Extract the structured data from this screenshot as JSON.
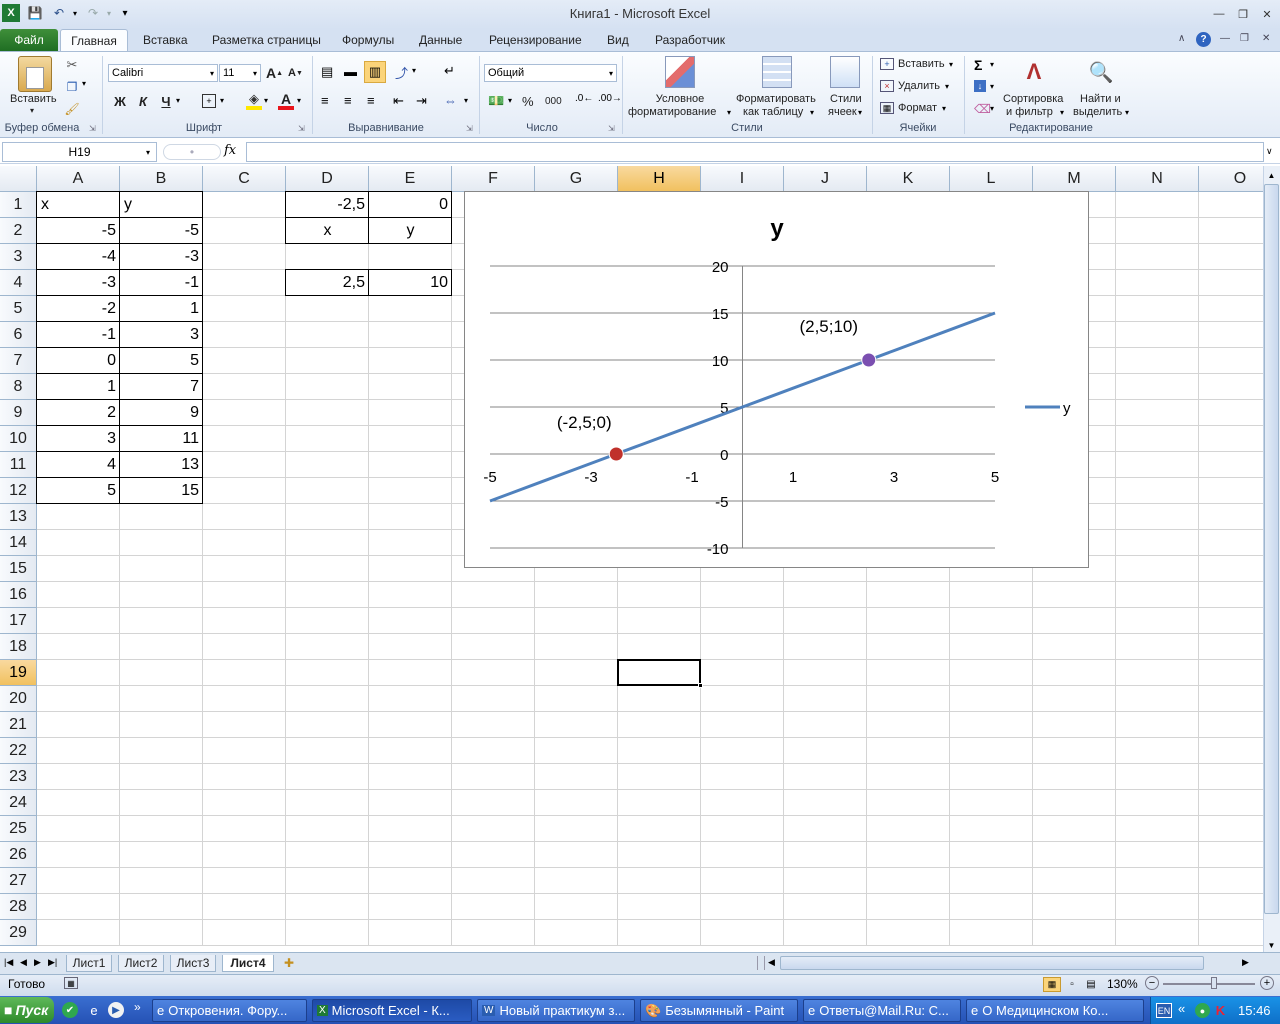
{
  "window": {
    "title": "Книга1  -  Microsoft Excel"
  },
  "ribbon_tabs": [
    "Файл",
    "Главная",
    "Вставка",
    "Разметка страницы",
    "Формулы",
    "Данные",
    "Рецензирование",
    "Вид",
    "Разработчик"
  ],
  "ribbon": {
    "clipboard": {
      "paste": "Вставить",
      "label": "Буфер обмена"
    },
    "font": {
      "name": "Calibri",
      "size": "11",
      "bold": "Ж",
      "italic": "К",
      "underline": "Ч",
      "label": "Шрифт"
    },
    "alignment": {
      "label": "Выравнивание"
    },
    "number": {
      "format": "Общий",
      "percent": "%",
      "thousands": "000",
      "label": "Число"
    },
    "styles": {
      "conditional_1": "Условное",
      "conditional_2": "форматирование",
      "astable_1": "Форматировать",
      "astable_2": "как таблицу",
      "cell_1": "Стили",
      "cell_2": "ячеек",
      "label": "Стили"
    },
    "cells": {
      "insert": "Вставить",
      "delete": "Удалить",
      "format": "Формат",
      "label": "Ячейки"
    },
    "editing": {
      "sort_1": "Сортировка",
      "sort_2": "и фильтр",
      "find_1": "Найти и",
      "find_2": "выделить",
      "label": "Редактирование"
    }
  },
  "formula_bar": {
    "name_box": "H19",
    "fx": "fx",
    "value": ""
  },
  "columns": [
    "A",
    "B",
    "C",
    "D",
    "E",
    "F",
    "G",
    "H",
    "I",
    "J",
    "K",
    "L",
    "M",
    "N",
    "O"
  ],
  "rows": [
    "1",
    "2",
    "3",
    "4",
    "5",
    "6",
    "7",
    "8",
    "9",
    "10",
    "11",
    "12",
    "13",
    "14",
    "15",
    "16",
    "17",
    "18",
    "19",
    "20",
    "21",
    "22",
    "23",
    "24",
    "25",
    "26",
    "27",
    "28",
    "29"
  ],
  "selected_cell": "H19",
  "cells": {
    "A1": "x",
    "B1": "y",
    "A2": "-5",
    "B2": "-5",
    "A3": "-4",
    "B3": "-3",
    "A4": "-3",
    "B4": "-1",
    "A5": "-2",
    "B5": "1",
    "A6": "-1",
    "B6": "3",
    "A7": "0",
    "B7": "5",
    "A8": "1",
    "B8": "7",
    "A9": "2",
    "B9": "9",
    "A10": "3",
    "B10": "11",
    "A11": "4",
    "B11": "13",
    "A12": "5",
    "B12": "15",
    "D1": "-2,5",
    "E1": "0",
    "D2": "x",
    "E2": "y",
    "D4": "2,5",
    "E4": "10"
  },
  "chart_data": {
    "type": "scatter",
    "title": "y",
    "series": [
      {
        "name": "y",
        "x": [
          -5,
          -4,
          -3,
          -2,
          -1,
          0,
          1,
          2,
          3,
          4,
          5
        ],
        "y": [
          -5,
          -3,
          -1,
          1,
          3,
          5,
          7,
          9,
          11,
          13,
          15
        ],
        "color": "#4f81bd"
      }
    ],
    "markers": [
      {
        "x": -2.5,
        "y": 0,
        "label": "(-2,5;0)",
        "color": "#c0312b"
      },
      {
        "x": 2.5,
        "y": 10,
        "label": "(2,5;10)",
        "color": "#7b4fb0"
      }
    ],
    "xlim": [
      -5,
      5
    ],
    "ylim": [
      -10,
      20
    ],
    "xticks": [
      "-5",
      "-3",
      "-1",
      "1",
      "3",
      "5"
    ],
    "yticks": [
      "20",
      "15",
      "10",
      "5",
      "0",
      "-5",
      "-10"
    ],
    "grid": true,
    "legend": "right"
  },
  "sheet_tabs": [
    "Лист1",
    "Лист2",
    "Лист3",
    "Лист4"
  ],
  "active_sheet": "Лист4",
  "status": {
    "ready": "Готово",
    "zoom": "130%"
  },
  "taskbar": {
    "start": "Пуск",
    "items": [
      "Откровения. Фору...",
      "Microsoft Excel - К...",
      "Новый практикум з...",
      "Безымянный - Paint",
      "Ответы@Mail.Ru: С...",
      "О Медицинском Ко..."
    ],
    "lang": "EN",
    "clock": "15:46"
  }
}
